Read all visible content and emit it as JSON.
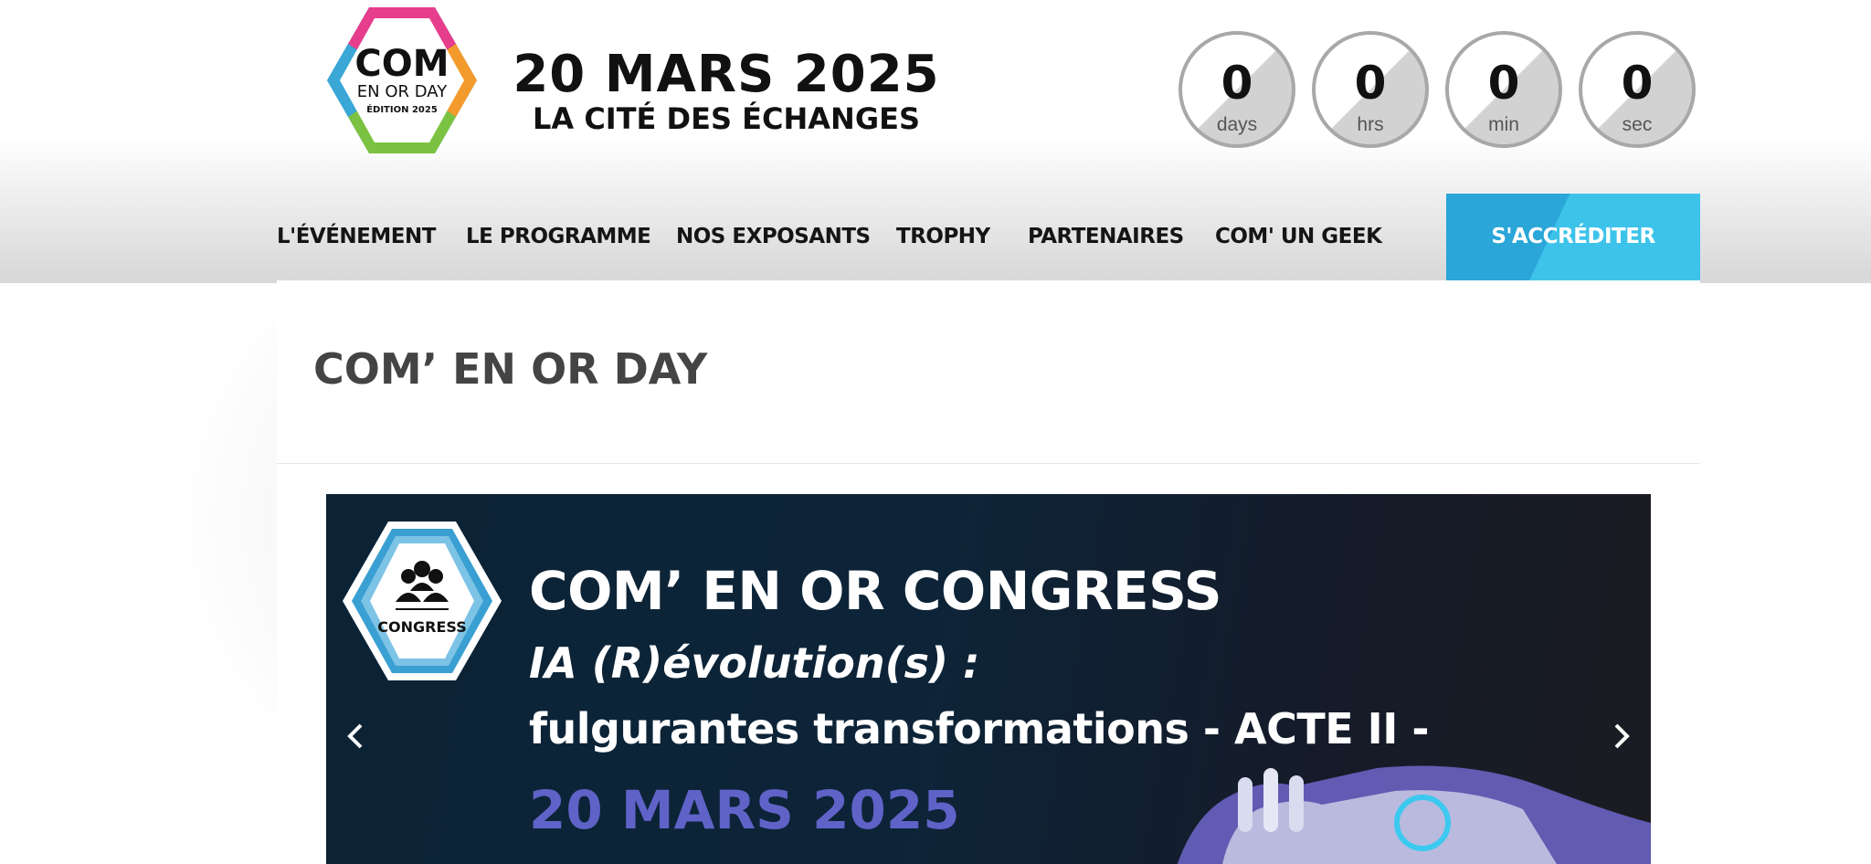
{
  "header": {
    "logo": {
      "line1": "COM",
      "line2": "EN OR DAY",
      "line3": "ÉDITION 2025"
    },
    "date_main": "20 MARS 2025",
    "date_sub": "LA CITÉ DES ÉCHANGES",
    "countdown": [
      {
        "value": "0",
        "label": "days"
      },
      {
        "value": "0",
        "label": "hrs"
      },
      {
        "value": "0",
        "label": "min"
      },
      {
        "value": "0",
        "label": "sec"
      }
    ]
  },
  "nav": {
    "items": [
      {
        "label": "L'ÉVÉNEMENT"
      },
      {
        "label": "LE PROGRAMME"
      },
      {
        "label": "NOS EXPOSANTS"
      },
      {
        "label": "TROPHY"
      },
      {
        "label": "PARTENAIRES"
      },
      {
        "label": "COM' UN GEEK"
      }
    ],
    "cta_label": "S'ACCRÉDITER"
  },
  "main": {
    "page_title": "COM’ EN OR DAY",
    "slider": {
      "badge_label": "CONGRESS",
      "title": "COM’ EN OR CONGRESS",
      "line1": "IA (R)évolution(s) :",
      "line2": "fulgurantes transformations   - ACTE II -",
      "line3": "20 MARS 2025",
      "prev_icon": "chevron-left-icon",
      "next_icon": "chevron-right-icon"
    }
  },
  "colors": {
    "accent": "#3dc3ea",
    "banner_bg": "#0d2438",
    "date_purple": "#5f63c8",
    "title_grey": "#444444"
  }
}
